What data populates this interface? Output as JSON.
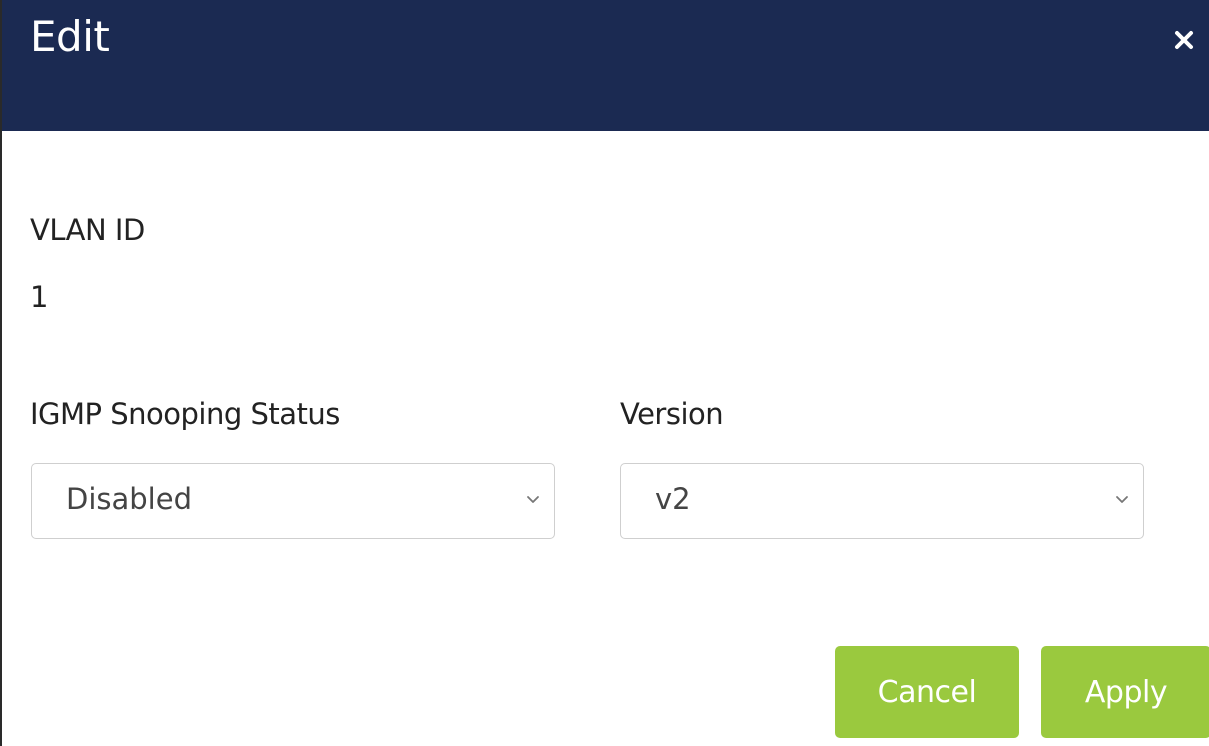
{
  "dialog": {
    "title": "Edit",
    "close_icon": "close-icon"
  },
  "fields": {
    "vlan_id": {
      "label": "VLAN ID",
      "value": "1"
    },
    "igmp_snooping_status": {
      "label": "IGMP Snooping Status",
      "selected": "Disabled",
      "icon": "chevron-down-icon"
    },
    "version": {
      "label": "Version",
      "selected": "v2",
      "icon": "chevron-down-icon"
    }
  },
  "buttons": {
    "cancel_label": "Cancel",
    "apply_label": "Apply"
  },
  "colors": {
    "header_bg": "#1b2a52",
    "button_bg": "#9ac93e",
    "button_text": "#ffffff"
  }
}
